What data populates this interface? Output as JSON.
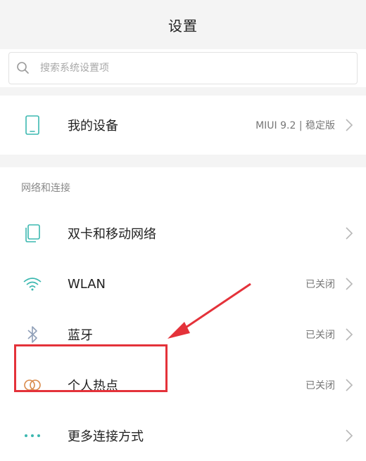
{
  "header": {
    "title": "设置"
  },
  "search": {
    "placeholder": "搜索系统设置项"
  },
  "device": {
    "label": "我的设备",
    "status": "MIUI 9.2 | 稳定版"
  },
  "section": {
    "title": "网络和连接"
  },
  "items": [
    {
      "label": "双卡和移动网络",
      "status": "",
      "icon": "sim-card-icon"
    },
    {
      "label": "WLAN",
      "status": "已关闭",
      "icon": "wifi-icon"
    },
    {
      "label": "蓝牙",
      "status": "已关闭",
      "icon": "bluetooth-icon"
    },
    {
      "label": "个人热点",
      "status": "已关闭",
      "icon": "hotspot-icon"
    },
    {
      "label": "更多连接方式",
      "status": "",
      "icon": "more-dots-icon"
    }
  ],
  "colors": {
    "accent": "#3cb8b0",
    "highlight": "#e4323a",
    "hotspot": "#d98a4a"
  }
}
